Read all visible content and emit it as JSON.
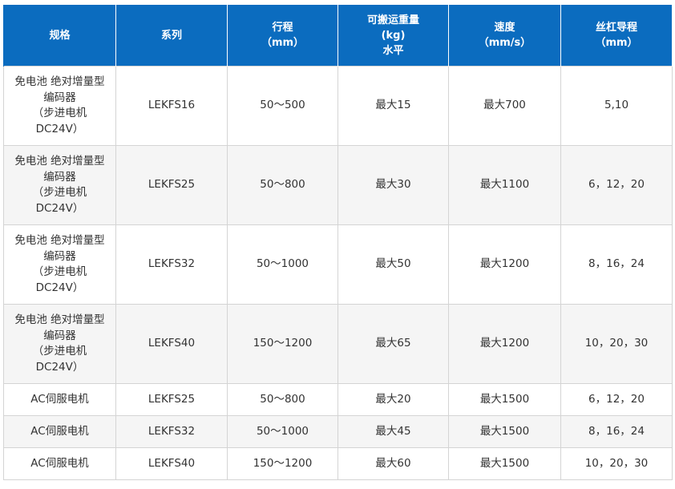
{
  "header": {
    "spec": "规格",
    "series": "系列",
    "stroke": [
      "行程",
      "（mm）"
    ],
    "payload": [
      "可搬运重量",
      "(kg)",
      "水平"
    ],
    "speed": [
      "速度",
      "（mm/s）"
    ],
    "lead": [
      "丝杠导程",
      "（mm）"
    ]
  },
  "rows": [
    {
      "spec": [
        "免电池 绝对增量型",
        "编码器",
        "（步进电机",
        "DC24V）"
      ],
      "series": "LEKFS16",
      "stroke": "50～500",
      "payload": "最大15",
      "speed": "最大700",
      "lead": "5,10"
    },
    {
      "spec": [
        "免电池 绝对增量型",
        "编码器",
        "（步进电机",
        "DC24V）"
      ],
      "series": "LEKFS25",
      "stroke": "50～800",
      "payload": "最大30",
      "speed": "最大1100",
      "lead": "6，12，20"
    },
    {
      "spec": [
        "免电池 绝对增量型",
        "编码器",
        "（步进电机",
        "DC24V）"
      ],
      "series": "LEKFS32",
      "stroke": "50～1000",
      "payload": "最大50",
      "speed": "最大1200",
      "lead": "8，16，24"
    },
    {
      "spec": [
        "免电池 绝对增量型",
        "编码器",
        "（步进电机",
        "DC24V）"
      ],
      "series": "LEKFS40",
      "stroke": "150～1200",
      "payload": "最大65",
      "speed": "最大1200",
      "lead": "10，20，30"
    },
    {
      "spec": [
        "AC伺服电机"
      ],
      "series": "LEKFS25",
      "stroke": "50～800",
      "payload": "最大20",
      "speed": "最大1500",
      "lead": "6，12，20"
    },
    {
      "spec": [
        "AC伺服电机"
      ],
      "series": "LEKFS32",
      "stroke": "50～1000",
      "payload": "最大45",
      "speed": "最大1500",
      "lead": "8，16，24"
    },
    {
      "spec": [
        "AC伺服电机"
      ],
      "series": "LEKFS40",
      "stroke": "150～1200",
      "payload": "最大60",
      "speed": "最大1500",
      "lead": "10，20，30"
    }
  ],
  "colors": {
    "header_bg": "#0b6cbf",
    "header_text": "#ffffff",
    "row_alt_bg": "#f5f5f5",
    "border": "#d4d4d4",
    "body_text": "#333333"
  }
}
